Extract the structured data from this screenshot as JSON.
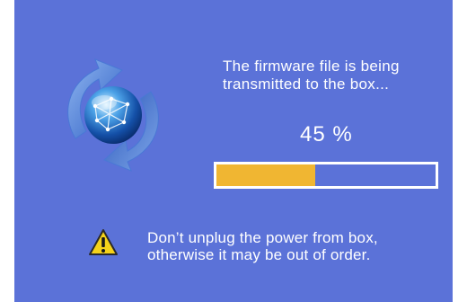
{
  "message": {
    "line": "The firmware file is being\ntransmitted to the box..."
  },
  "progress": {
    "percent_label": "45  %",
    "fraction": 0.45
  },
  "warning": {
    "text": "Don’t unplug the power from box,\notherwise it may be out of order."
  },
  "icons": {
    "sync": "sync-globe-icon",
    "warning": "warning-icon"
  },
  "colors": {
    "background": "#5b72d8",
    "progress_fill": "#f0b632",
    "progress_border": "#ffffff",
    "text": "#ffffff"
  }
}
